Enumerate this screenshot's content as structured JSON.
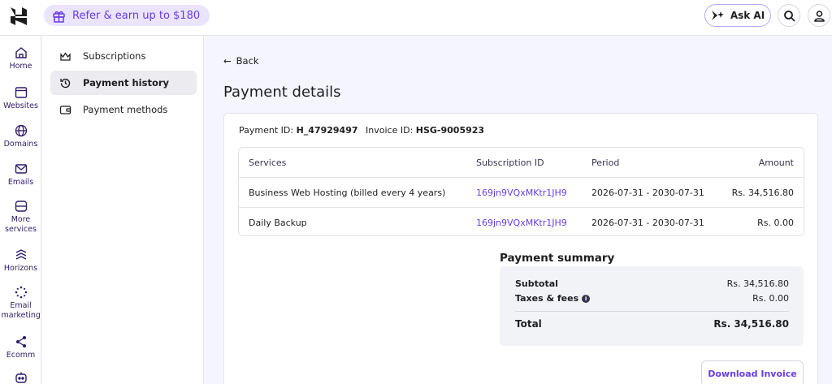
{
  "topbar": {
    "refer_label": "Refer & earn up to $180",
    "ask_ai_label": "Ask AI"
  },
  "rail": [
    {
      "label": "Home",
      "icon": "home-icon"
    },
    {
      "label": "Websites",
      "icon": "browser-icon"
    },
    {
      "label": "Domains",
      "icon": "globe-icon"
    },
    {
      "label": "Emails",
      "icon": "mail-icon"
    },
    {
      "label": "More services",
      "icon": "server-icon"
    },
    {
      "label": "Horizons",
      "icon": "waves-icon"
    },
    {
      "label": "Email marketing",
      "icon": "sparkle-icon"
    },
    {
      "label": "Ecomm",
      "icon": "share-nodes-icon"
    }
  ],
  "subnav": [
    {
      "label": "Subscriptions",
      "icon": "crown-icon"
    },
    {
      "label": "Payment history",
      "icon": "history-icon",
      "active": true
    },
    {
      "label": "Payment methods",
      "icon": "wallet-icon"
    }
  ],
  "back_label": "Back",
  "page_title": "Payment details",
  "ids": {
    "payment_label": "Payment ID:",
    "payment_value": "H_47929497",
    "invoice_label": "Invoice ID:",
    "invoice_value": "HSG-9005923"
  },
  "table": {
    "headers": [
      "Services",
      "Subscription ID",
      "Period",
      "Amount"
    ],
    "rows": [
      [
        "Business Web Hosting (billed every 4 years)",
        "169jn9VQxMKtr1JH9",
        "2026-07-31 - 2030-07-31",
        "Rs. 34,516.80"
      ],
      [
        "Daily Backup",
        "169jn9VQxMKtr1JH9",
        "2026-07-31 - 2030-07-31",
        "Rs. 0.00"
      ]
    ]
  },
  "summary": {
    "title": "Payment summary",
    "subtotal_label": "Subtotal",
    "subtotal_value": "Rs. 34,516.80",
    "taxes_label": "Taxes & fees",
    "taxes_value": "Rs. 0.00",
    "total_label": "Total",
    "total_value": "Rs. 34,516.80"
  },
  "download_label": "Download Invoice",
  "colors": {
    "accent": "#673de6",
    "accent_bg": "#ebe4ff"
  }
}
